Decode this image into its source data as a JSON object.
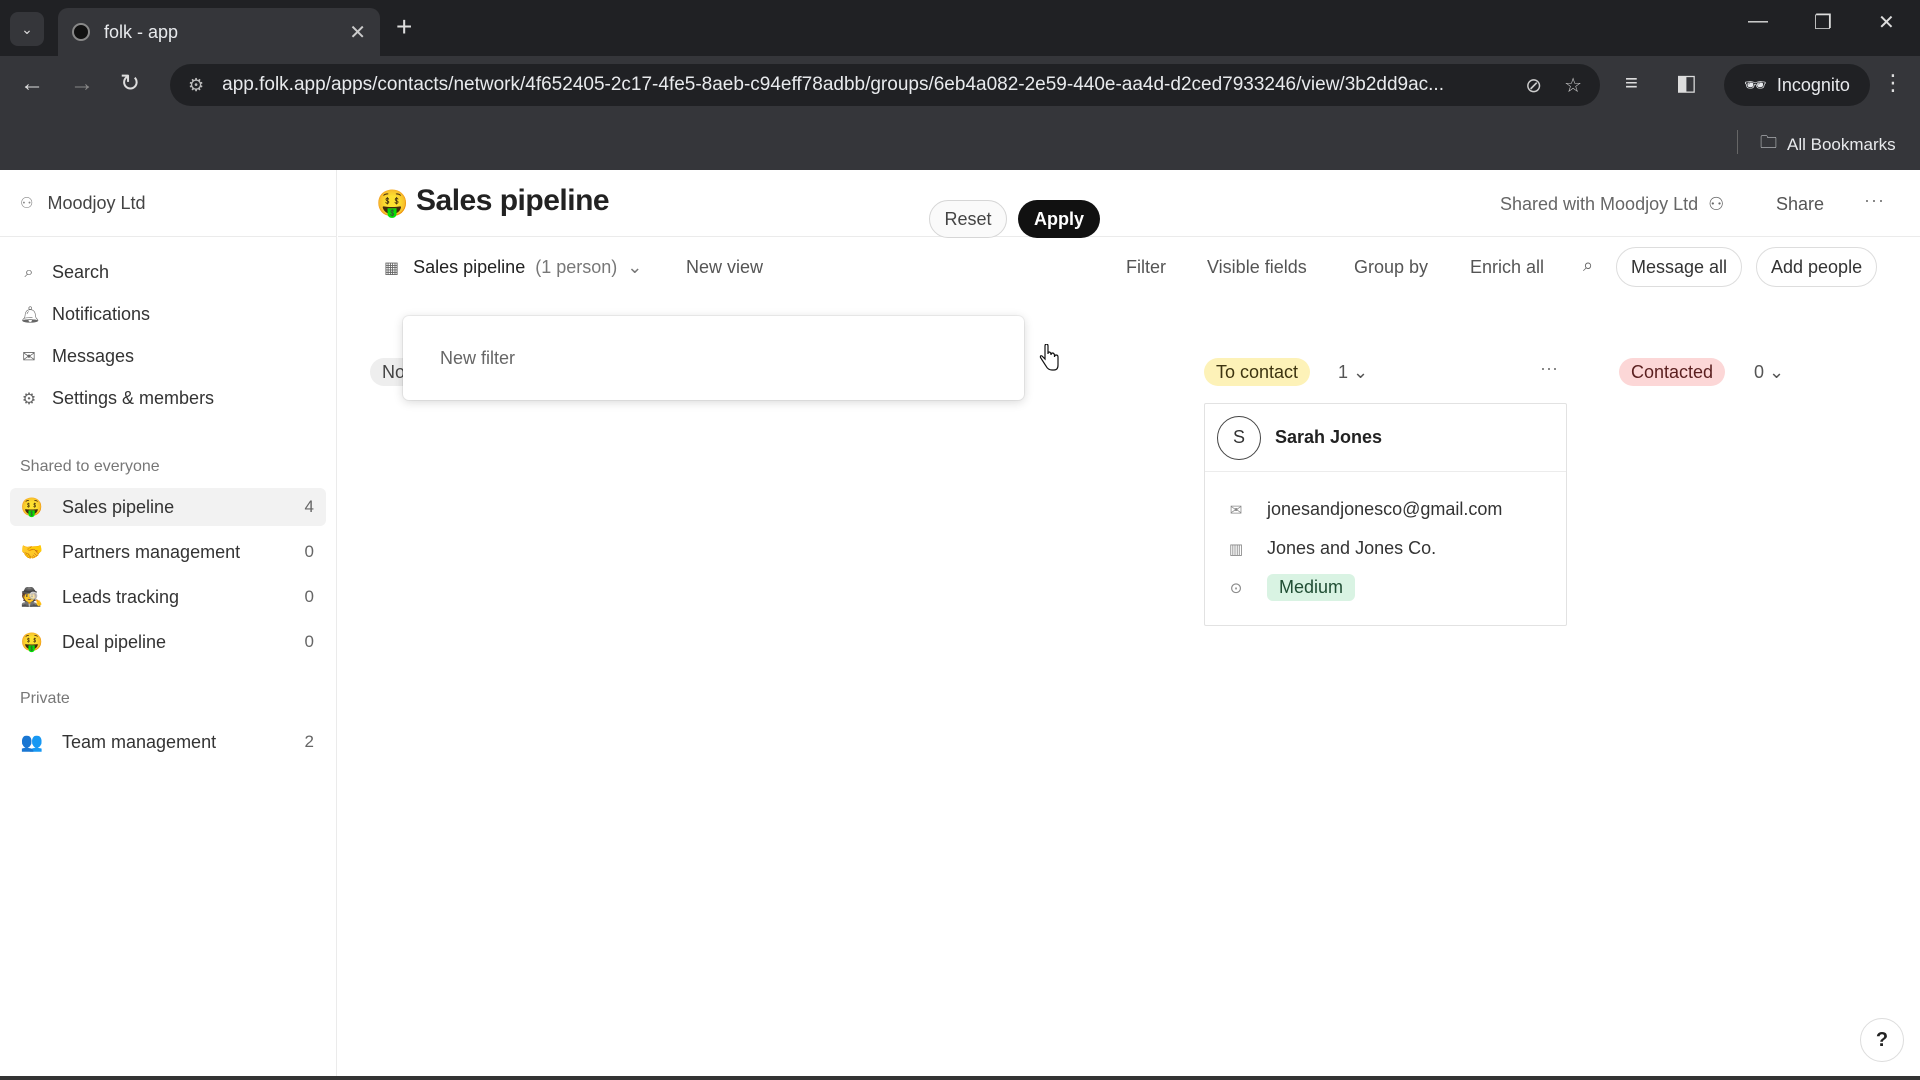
{
  "browser": {
    "tab_title": "folk - app",
    "url": "app.folk.app/apps/contacts/network/4f652405-2c17-4fe5-8aeb-c94eff78adbb/groups/6eb4a082-2e59-440e-aa4d-d2ced7933246/view/3b2dd9ac...",
    "incognito_label": "Incognito",
    "all_bookmarks_label": "All Bookmarks"
  },
  "sidebar": {
    "workspace": "Moodjoy Ltd",
    "nav": [
      {
        "label": "Search",
        "icon": "search-icon"
      },
      {
        "label": "Notifications",
        "icon": "bell-icon"
      },
      {
        "label": "Messages",
        "icon": "envelope-icon"
      },
      {
        "label": "Settings & members",
        "icon": "gear-icon"
      }
    ],
    "shared_label": "Shared to everyone",
    "shared_groups": [
      {
        "emoji": "🤑",
        "label": "Sales pipeline",
        "count": "4"
      },
      {
        "emoji": "🤝",
        "label": "Partners management",
        "count": "0"
      },
      {
        "emoji": "🕵",
        "label": "Leads tracking",
        "count": "0"
      },
      {
        "emoji": "🤑",
        "label": "Deal pipeline",
        "count": "0"
      }
    ],
    "private_label": "Private",
    "private_groups": [
      {
        "emoji": "👥",
        "label": "Team management",
        "count": "2"
      }
    ]
  },
  "header": {
    "emoji": "🤑",
    "title": "Sales pipeline",
    "shared_with": "Shared with Moodjoy Ltd",
    "share_label": "Share",
    "more_label": "···"
  },
  "view_bar": {
    "view_name": "Sales pipeline",
    "view_count": "(1 person)",
    "new_view": "New view",
    "filter": "Filter",
    "visible_fields": "Visible fields",
    "group_by": "Group by",
    "enrich_all": "Enrich all",
    "message_all": "Message all",
    "add_people": "Add people"
  },
  "filter_popover": {
    "placeholder": "New filter",
    "reset_label": "Reset",
    "apply_label": "Apply"
  },
  "kanban": {
    "partial_column_tag": "No",
    "columns": [
      {
        "label": "To contact",
        "count": "1",
        "color": "#fdf2b8"
      },
      {
        "label": "Contacted",
        "count": "0",
        "color": "#fcd7d7"
      }
    ],
    "column_more": "···",
    "card": {
      "initial": "S",
      "name": "Sarah Jones",
      "email": "jonesandjonesco@gmail.com",
      "company": "Jones and Jones Co.",
      "priority": "Medium"
    }
  },
  "help_label": "?"
}
